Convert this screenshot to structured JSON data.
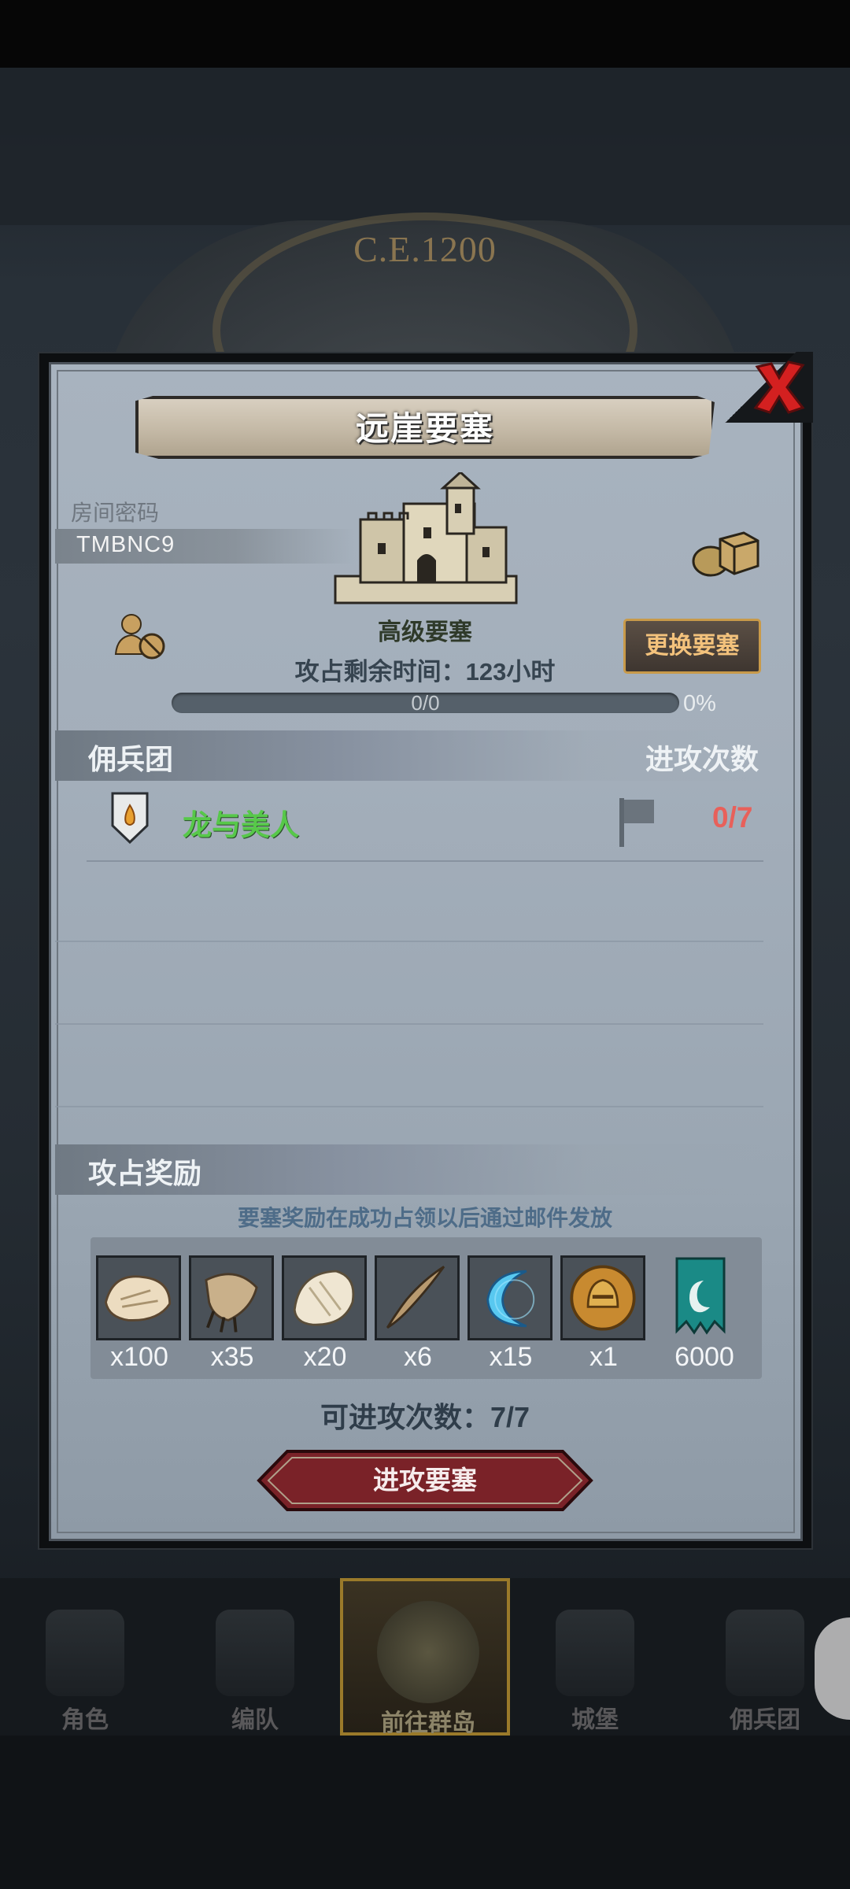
{
  "background": {
    "era_label": "C.E.1200"
  },
  "dialog": {
    "title": "远崖要塞",
    "room_code_label": "房间密码",
    "room_code": "TMBNC9",
    "fortress_grade": "高级要塞",
    "change_button_label": "更换要塞",
    "remaining_time_label": "攻占剩余时间：123小时",
    "progress": {
      "text": "0/0",
      "percent_label": "0%",
      "fraction": 0
    },
    "mercenary_header": "佣兵团",
    "attack_count_header": "进攻次数",
    "guild_rows": [
      {
        "name": "龙与美人",
        "count": "0/7"
      }
    ],
    "reward_header": "攻占奖励",
    "reward_note": "要塞奖励在成功占领以后通过邮件发放",
    "rewards": [
      {
        "icon": "fur-pelt-icon",
        "qty": "x100"
      },
      {
        "icon": "claw-icon",
        "qty": "x35"
      },
      {
        "icon": "white-fur-icon",
        "qty": "x20"
      },
      {
        "icon": "horn-icon",
        "qty": "x6"
      },
      {
        "icon": "blue-crescent-icon",
        "qty": "x15"
      },
      {
        "icon": "knight-helmet-coin-icon",
        "qty": "x1"
      },
      {
        "icon": "guild-banner-icon",
        "qty": "6000"
      }
    ],
    "remaining_attacks_label": "可进攻次数：7/7",
    "attack_button_label": "进攻要塞"
  },
  "bottom_nav": {
    "items": [
      {
        "label": "角色"
      },
      {
        "label": "编队"
      },
      {
        "label": "前往群岛",
        "active": true
      },
      {
        "label": "城堡"
      },
      {
        "label": "佣兵团"
      }
    ]
  },
  "colors": {
    "accent_gold": "#c89a4a",
    "guild_name_green": "#57c84a",
    "count_red": "#e8605a",
    "close_red": "#d42020",
    "attack_button": "#8a2a2e"
  }
}
